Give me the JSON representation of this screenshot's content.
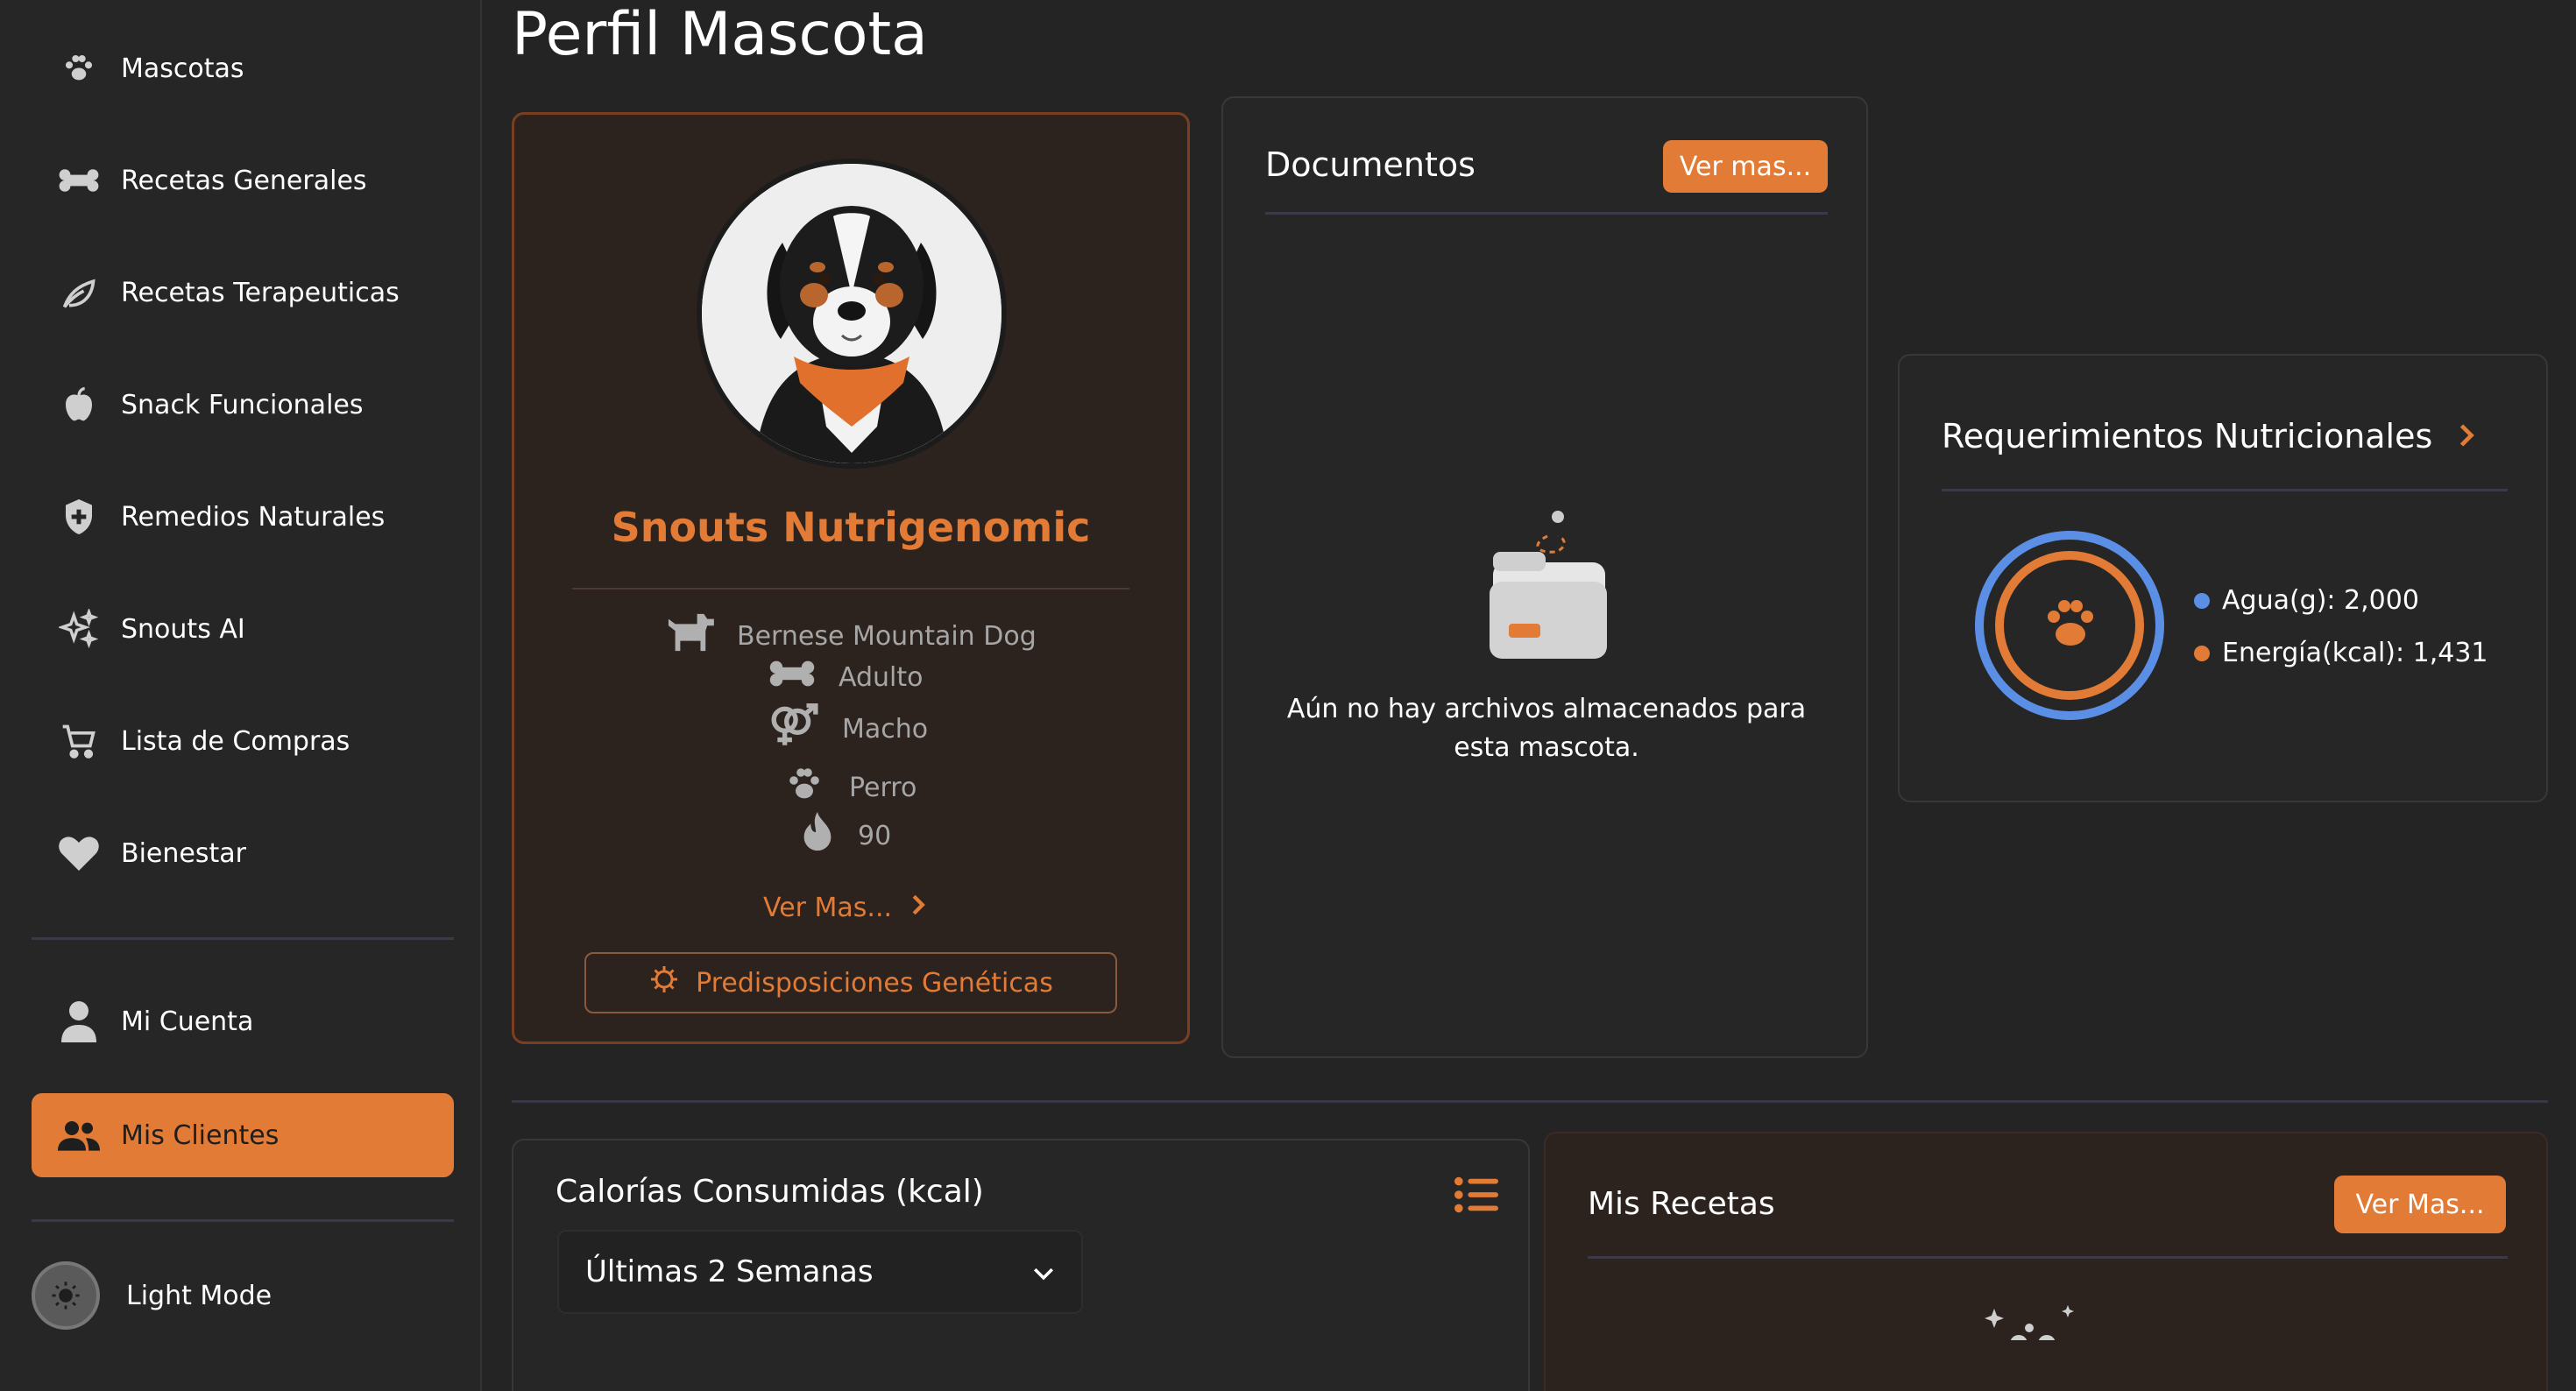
{
  "sidebar": {
    "items": [
      {
        "label": "Mascotas",
        "icon": "paw-icon"
      },
      {
        "label": "Recetas Generales",
        "icon": "bone-icon"
      },
      {
        "label": "Recetas Terapeuticas",
        "icon": "leaf-icon"
      },
      {
        "label": "Snack Funcionales",
        "icon": "apple-icon"
      },
      {
        "label": "Remedios Naturales",
        "icon": "shield-plus-icon"
      },
      {
        "label": "Snouts AI",
        "icon": "sparkles-icon"
      },
      {
        "label": "Lista de Compras",
        "icon": "cart-icon"
      },
      {
        "label": "Bienestar",
        "icon": "heart-icon"
      }
    ],
    "account": {
      "label": "Mi Cuenta",
      "icon": "user-icon"
    },
    "clients": {
      "label": "Mis Clientes",
      "icon": "users-icon"
    },
    "theme_label": "Light Mode"
  },
  "page": {
    "title": "Perfil Mascota"
  },
  "pet": {
    "name": "Snouts Nutrigenomic",
    "breed": "Bernese Mountain Dog",
    "age_stage": "Adulto",
    "sex": "Macho",
    "species": "Perro",
    "value": "90",
    "ver_mas": "Ver Mas...",
    "genetic_button": "Predisposiciones Genéticas"
  },
  "documents": {
    "title": "Documentos",
    "button": "Ver mas...",
    "empty_text": "Aún no hay archivos almacenados para esta mascota."
  },
  "nutrition": {
    "title": "Requerimientos Nutricionales",
    "water": "Agua(g): 2,000",
    "energy": "Energía(kcal): 1,431"
  },
  "calories": {
    "title": "Calorías Consumidas (kcal)",
    "selected_range": "Últimas 2 Semanas"
  },
  "recipes": {
    "title": "Mis Recetas",
    "button": "Ver Mas..."
  },
  "colors": {
    "accent": "#e17b36",
    "water_blue": "#5b8fe6",
    "energy_orange": "#e17b36"
  }
}
